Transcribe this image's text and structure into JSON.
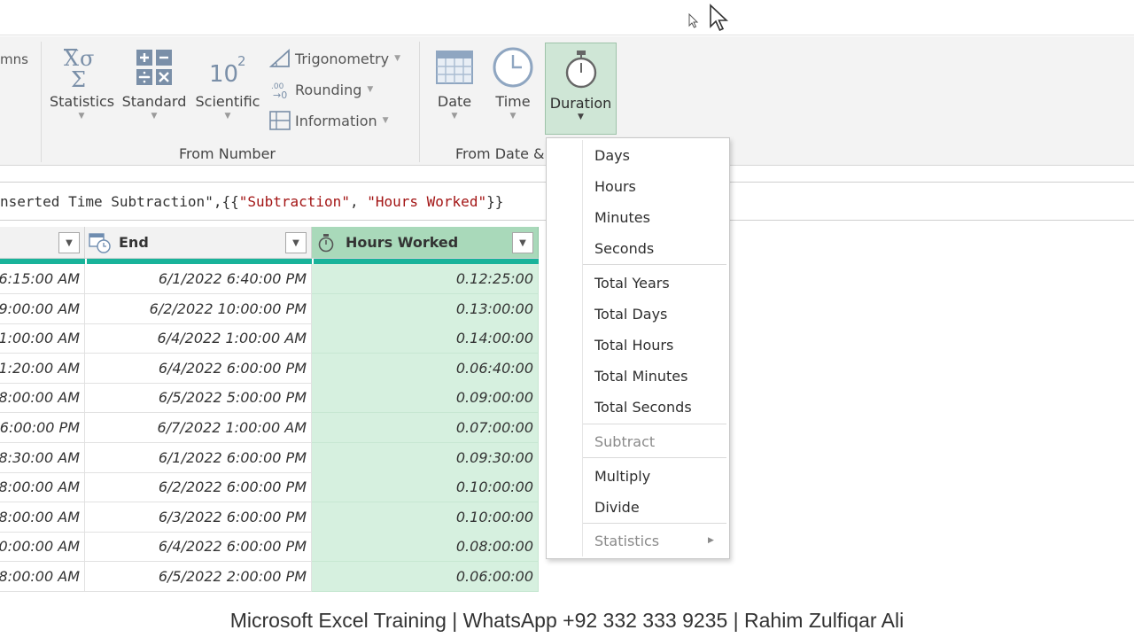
{
  "ribbon": {
    "partial_columns_label": "mns",
    "buttons": {
      "statistics": "Statistics",
      "standard": "Standard",
      "scientific": "Scientific",
      "trigonometry": "Trigonometry",
      "rounding": "Rounding",
      "information": "Information",
      "date": "Date",
      "time": "Time",
      "duration": "Duration"
    },
    "groups": {
      "from_number": "From Number",
      "from_date": "From Date &"
    },
    "scientific_icon": {
      "base": "10",
      "exp": "2"
    }
  },
  "formula": {
    "prefix": "nserted Time Subtraction\",{{",
    "str1": "\"Subtraction\"",
    "mid": ", ",
    "str2": "\"Hours Worked\"",
    "suffix": "}}"
  },
  "grid": {
    "columns": [
      {
        "name": ""
      },
      {
        "name": "End"
      },
      {
        "name": "Hours Worked"
      }
    ],
    "rows": [
      [
        "6:15:00 AM",
        "6/1/2022 6:40:00 PM",
        "0.12:25:00"
      ],
      [
        "9:00:00 AM",
        "6/2/2022 10:00:00 PM",
        "0.13:00:00"
      ],
      [
        "1:00:00 AM",
        "6/4/2022 1:00:00 AM",
        "0.14:00:00"
      ],
      [
        "1:20:00 AM",
        "6/4/2022 6:00:00 PM",
        "0.06:40:00"
      ],
      [
        "8:00:00 AM",
        "6/5/2022 5:00:00 PM",
        "0.09:00:00"
      ],
      [
        "6:00:00 PM",
        "6/7/2022 1:00:00 AM",
        "0.07:00:00"
      ],
      [
        "8:30:00 AM",
        "6/1/2022 6:00:00 PM",
        "0.09:30:00"
      ],
      [
        "8:00:00 AM",
        "6/2/2022 6:00:00 PM",
        "0.10:00:00"
      ],
      [
        "8:00:00 AM",
        "6/3/2022 6:00:00 PM",
        "0.10:00:00"
      ],
      [
        "0:00:00 AM",
        "6/4/2022 6:00:00 PM",
        "0.08:00:00"
      ],
      [
        "8:00:00 AM",
        "6/5/2022 2:00:00 PM",
        "0.06:00:00"
      ]
    ]
  },
  "menu": {
    "items": [
      {
        "label": "Days",
        "disabled": false
      },
      {
        "label": "Hours",
        "disabled": false
      },
      {
        "label": "Minutes",
        "disabled": false
      },
      {
        "label": "Seconds",
        "disabled": false
      },
      {
        "label": "Total Years",
        "disabled": false
      },
      {
        "label": "Total Days",
        "disabled": false
      },
      {
        "label": "Total Hours",
        "disabled": false
      },
      {
        "label": "Total Minutes",
        "disabled": false
      },
      {
        "label": "Total Seconds",
        "disabled": false
      },
      {
        "label": "Subtract",
        "disabled": true
      },
      {
        "label": "Multiply",
        "disabled": false
      },
      {
        "label": "Divide",
        "disabled": false
      },
      {
        "label": "Statistics",
        "disabled": true,
        "submenu": true
      }
    ]
  },
  "footer": {
    "text": "Microsoft Excel Training | WhatsApp +92 332 333 9235 | Rahim Zulfiqar Ali"
  },
  "colors": {
    "accent_green": "#a9d9ba",
    "selected_column": "#d6f0df",
    "quality_bar": "#19b39a",
    "string_red": "#a31515"
  }
}
